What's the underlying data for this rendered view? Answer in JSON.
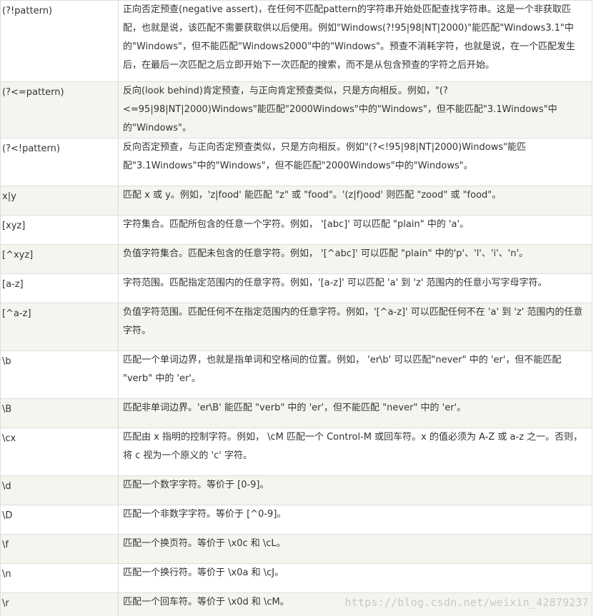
{
  "rows": [
    {
      "pattern": "(?!pattern)",
      "description": "正向否定预查(negative assert)，在任何不匹配pattern的字符串开始处匹配查找字符串。这是一个非获取匹配，也就是说，该匹配不需要获取供以后使用。例如\"Windows(?!95|98|NT|2000)\"能匹配\"Windows3.1\"中的\"Windows\"，但不能匹配\"Windows2000\"中的\"Windows\"。预查不消耗字符，也就是说，在一个匹配发生后，在最后一次匹配之后立即开始下一次匹配的搜索，而不是从包含预查的字符之后开始。"
    },
    {
      "pattern": "(?<=pattern)",
      "description": "反向(look behind)肯定预查，与正向肯定预查类似，只是方向相反。例如，\"(?<=95|98|NT|2000)Windows\"能匹配\"2000Windows\"中的\"Windows\"，但不能匹配\"3.1Windows\"中的\"Windows\"。"
    },
    {
      "pattern": "(?<!pattern)",
      "description": "反向否定预查，与正向否定预查类似，只是方向相反。例如\"(?<!95|98|NT|2000)Windows\"能匹配\"3.1Windows\"中的\"Windows\"，但不能匹配\"2000Windows\"中的\"Windows\"。"
    },
    {
      "pattern": "x|y",
      "description": "匹配 x 或 y。例如，'z|food' 能匹配 \"z\" 或 \"food\"。'(z|f)ood' 则匹配 \"zood\" 或 \"food\"。"
    },
    {
      "pattern": "[xyz]",
      "description": "字符集合。匹配所包含的任意一个字符。例如， '[abc]' 可以匹配 \"plain\" 中的 'a'。"
    },
    {
      "pattern": "[^xyz]",
      "description": "负值字符集合。匹配未包含的任意字符。例如， '[^abc]' 可以匹配 \"plain\" 中的'p'、'l'、'i'、'n'。"
    },
    {
      "pattern": "[a-z]",
      "description": "字符范围。匹配指定范围内的任意字符。例如，'[a-z]' 可以匹配 'a' 到 'z' 范围内的任意小写字母字符。"
    },
    {
      "pattern": "[^a-z]",
      "description": "负值字符范围。匹配任何不在指定范围内的任意字符。例如，'[^a-z]' 可以匹配任何不在 'a' 到 'z' 范围内的任意字符。"
    },
    {
      "pattern": "\\b",
      "description": "匹配一个单词边界，也就是指单词和空格间的位置。例如， 'er\\b' 可以匹配\"never\" 中的 'er'，但不能匹配 \"verb\" 中的 'er'。"
    },
    {
      "pattern": "\\B",
      "description": "匹配非单词边界。'er\\B' 能匹配 \"verb\" 中的 'er'，但不能匹配 \"never\" 中的 'er'。"
    },
    {
      "pattern": "\\cx",
      "description": "匹配由 x 指明的控制字符。例如， \\cM 匹配一个 Control-M 或回车符。x 的值必须为 A-Z 或 a-z 之一。否则，将 c 视为一个原义的 'c' 字符。"
    },
    {
      "pattern": "\\d",
      "description": "匹配一个数字字符。等价于 [0-9]。"
    },
    {
      "pattern": "\\D",
      "description": "匹配一个非数字字符。等价于 [^0-9]。"
    },
    {
      "pattern": "\\f",
      "description": "匹配一个换页符。等价于 \\x0c 和 \\cL。"
    },
    {
      "pattern": "\\n",
      "description": "匹配一个换行符。等价于 \\x0a 和 \\cJ。"
    },
    {
      "pattern": "\\r",
      "description": "匹配一个回车符。等价于 \\x0d 和 \\cM。"
    }
  ],
  "watermark": "https://blog.csdn.net/weixin_42879237"
}
